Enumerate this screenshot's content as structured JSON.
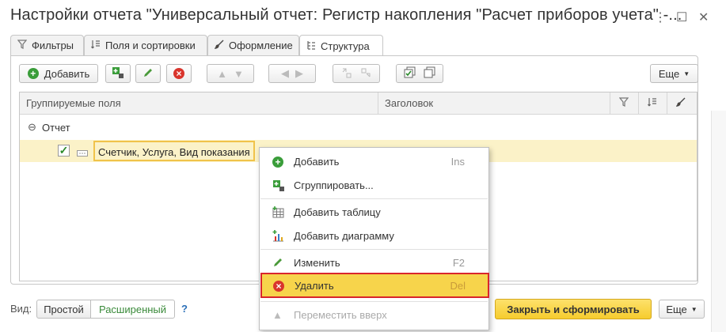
{
  "window": {
    "title": "Настройки отчета \"Универсальный отчет: Регистр накопления \"Расчет приборов учета\" -...",
    "more_icon": "⋮",
    "maximize_icon": "☐",
    "close_icon": "✕"
  },
  "tabs": [
    {
      "label": "Фильтры",
      "icon": "filter-icon"
    },
    {
      "label": "Поля и сортировки",
      "icon": "sort-icon"
    },
    {
      "label": "Оформление",
      "icon": "brush-icon"
    },
    {
      "label": "Структура",
      "icon": "structure-icon"
    }
  ],
  "toolbar": {
    "add_label": "Добавить",
    "more_label": "Еще"
  },
  "grid": {
    "columns": [
      "Группируемые поля",
      "Заголовок"
    ],
    "root_label": "Отчет",
    "row_label": "Счетчик, Услуга, Вид показания"
  },
  "context_menu": [
    {
      "label": "Добавить",
      "shortcut": "Ins",
      "icon": "add-icon"
    },
    {
      "label": "Сгруппировать...",
      "shortcut": "",
      "icon": "group-icon"
    },
    {
      "label": "Добавить таблицу",
      "shortcut": "",
      "icon": "table-icon"
    },
    {
      "label": "Добавить диаграмму",
      "shortcut": "",
      "icon": "chart-icon"
    },
    {
      "label": "Изменить",
      "shortcut": "F2",
      "icon": "edit-icon"
    },
    {
      "label": "Удалить",
      "shortcut": "Del",
      "icon": "delete-icon"
    },
    {
      "label": "Переместить вверх",
      "shortcut": "",
      "icon": "move-up-icon"
    }
  ],
  "footer": {
    "view_label": "Вид:",
    "simple_label": "Простой",
    "extended_label": "Расширенный",
    "help_label": "?",
    "close_build_label": "Закрыть и сформировать",
    "more_label": "Еще"
  },
  "colors": {
    "highlight": "#f7d44b",
    "highlight_border": "#d9262c",
    "selected_row": "#fbf2c8",
    "primary_button": "#f6cc2e"
  }
}
